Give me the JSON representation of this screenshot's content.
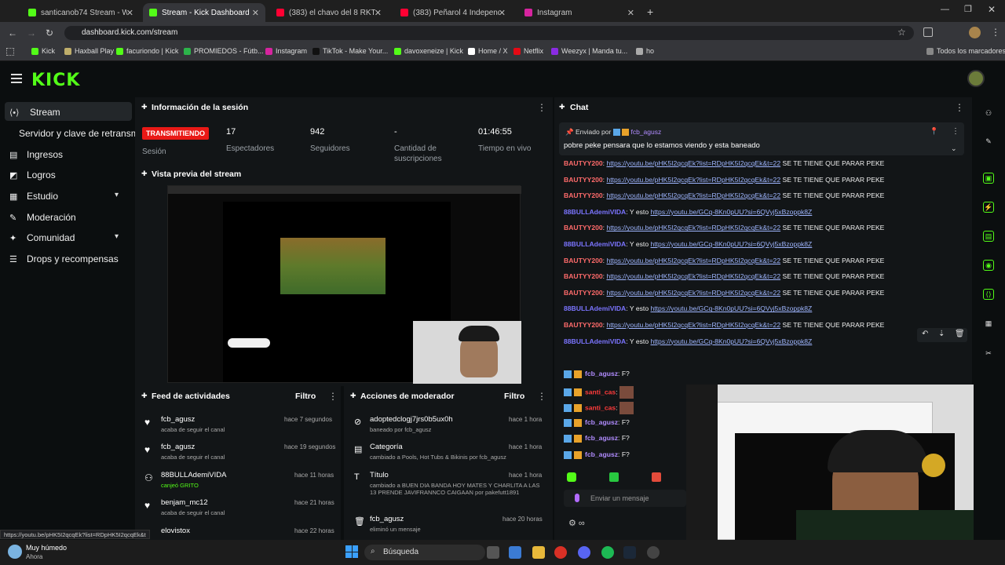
{
  "browser": {
    "tabs": [
      {
        "title": "santicanob74 Stream - Watch L",
        "color": "#53fc18"
      },
      {
        "title": "Stream - Kick Dashboard",
        "color": "#53fc18",
        "active": true
      },
      {
        "title": "(383) el chavo del 8 RKT saturs",
        "color": "#ff0033"
      },
      {
        "title": "(383) Peñarol 4 Independient",
        "color": "#ff0033"
      },
      {
        "title": "Instagram",
        "color": "#d6249f"
      }
    ],
    "url": "dashboard.kick.com/stream",
    "bookmarks": [
      "Kick",
      "Haxball Play",
      "facuriondo | Kick",
      "PROMIEDOS - Fútb...",
      "Instagram",
      "TikTok - Make Your...",
      "davoxeneize | Kick",
      "Home / X",
      "Netflix",
      "Weezyx | Manda tu...",
      "ho"
    ],
    "all_bookmarks": "Todos los marcadores"
  },
  "kick": {
    "logo": "KICK",
    "sidebar": {
      "stream": "Stream",
      "server": "Servidor y clave de retransmi",
      "items": [
        "Ingresos",
        "Logros",
        "Estudio",
        "Moderación",
        "Comunidad",
        "Drops y recompensas"
      ]
    },
    "session": {
      "title": "Información de la sesión",
      "live_badge": "TRANSMITIENDO",
      "session_label": "Sesión",
      "viewers": "17",
      "viewers_label": "Espectadores",
      "followers": "942",
      "followers_label": "Seguidores",
      "subs": "-",
      "subs_label": "Cantidad de suscripciones",
      "time": "01:46:55",
      "time_label": "Tiempo en vivo"
    },
    "preview_title": "Vista previa del stream",
    "feed": {
      "title": "Feed de actividades",
      "filter": "Filtro",
      "rows": [
        {
          "name": "fcb_agusz",
          "sub": "acaba de seguir el canal",
          "time": "hace 7 segundos"
        },
        {
          "name": "fcb_agusz",
          "sub": "acaba de seguir el canal",
          "time": "hace 19 segundos"
        },
        {
          "name": "88BULLAdemiVIDA",
          "sub": "canjeó GRITO",
          "time": "hace 11 horas"
        },
        {
          "name": "benjam_mc12",
          "sub": "acaba de seguir el canal",
          "time": "hace 21 horas"
        },
        {
          "name": "elovistox",
          "sub": "",
          "time": "hace 22 horas"
        }
      ]
    },
    "mod": {
      "title": "Acciones de moderador",
      "filter": "Filtro",
      "rows": [
        {
          "name": "adoptedclogj7jrs0b5ux0h",
          "sub": "baneado por fcb_agusz",
          "time": "hace 1 hora"
        },
        {
          "name": "Categoría",
          "sub": "cambiado a Pools, Hot Tubs & Bikinis por fcb_agusz",
          "time": "hace 1 hora"
        },
        {
          "name": "Título",
          "sub": "cambiado a BUEN DIA BANDA HOY MATES Y CHARLITA A LAS 13 PRENDE JAVIFRANNCO CAIGAAN por pakefutt1891",
          "time": "hace 1 hora"
        },
        {
          "name": "fcb_agusz",
          "sub": "eliminó un mensaje",
          "time": "hace 20 horas"
        }
      ]
    },
    "chat": {
      "title": "Chat",
      "pinned_by": "Enviado por",
      "pinned_user": "fcb_agusz",
      "pinned_msg": "pobre peke pensara que lo estamos viendo y esta baneado",
      "lines": [
        {
          "u": "BAUTYY200",
          "c": "u1",
          "link": "https://youtu.be/pHK5I2qcqEk?list=RDpHK5I2qcqEk&t=22",
          "rest": "SE TE TIENE QUE PARAR PEKE"
        },
        {
          "u": "BAUTYY200",
          "c": "u1",
          "link": "https://youtu.be/pHK5I2qcqEk?list=RDpHK5I2qcqEk&t=22",
          "rest": "SE TE TIENE QUE PARAR PEKE"
        },
        {
          "u": "BAUTYY200",
          "c": "u1",
          "link": "https://youtu.be/pHK5I2qcqEk?list=RDpHK5I2qcqEk&t=22",
          "rest": "SE TE TIENE QUE PARAR PEKE"
        },
        {
          "u": "88BULLAdemiVIDA",
          "c": "u2",
          "pre": "Y esto",
          "link": "https://youtu.be/GCq-8Kn0pUU?si=6QVyj5xBzoppk8Z",
          "rest": ""
        },
        {
          "u": "BAUTYY200",
          "c": "u1",
          "link": "https://youtu.be/pHK5I2qcqEk?list=RDpHK5I2qcqEk&t=22",
          "rest": "SE TE TIENE QUE PARAR PEKE"
        },
        {
          "u": "88BULLAdemiVIDA",
          "c": "u2",
          "pre": "Y esto",
          "link": "https://youtu.be/GCq-8Kn0pUU?si=6QVyj5xBzoppk8Z",
          "rest": ""
        },
        {
          "u": "BAUTYY200",
          "c": "u1",
          "link": "https://youtu.be/pHK5I2qcqEk?list=RDpHK5I2qcqEk&t=22",
          "rest": "SE TE TIENE QUE PARAR PEKE"
        },
        {
          "u": "BAUTYY200",
          "c": "u1",
          "link": "https://youtu.be/pHK5I2qcqEk?list=RDpHK5I2qcqEk&t=22",
          "rest": "SE TE TIENE QUE PARAR PEKE"
        },
        {
          "u": "BAUTYY200",
          "c": "u1",
          "link": "https://youtu.be/pHK5I2qcqEk?list=RDpHK5I2qcqEk&t=22",
          "rest": "SE TE TIENE QUE PARAR PEKE"
        },
        {
          "u": "88BULLAdemiVIDA",
          "c": "u2",
          "pre": "Y esto",
          "link": "https://youtu.be/GCq-8Kn0pUU?si=6QVyj5xBzoppk8Z",
          "rest": ""
        },
        {
          "u": "BAUTYY200",
          "c": "u1",
          "link": "https://youtu.be/pHK5I2qcqEk?list=RDpHK5I2qcqEk&t=22",
          "rest": "SE TE TIENE QUE PARAR PEKE"
        },
        {
          "u": "88BULLAdemiVIDA",
          "c": "u2",
          "pre": "Y esto",
          "link": "https://youtu.be/GCq-8Kn0pUU?si=6QVyj5xBzoppk8Z",
          "rest": ""
        }
      ],
      "short_lines": [
        {
          "u": "fcb_agusz",
          "msg": "F?"
        },
        {
          "u": "santi_cas",
          "msg": ""
        },
        {
          "u": "santi_cas",
          "msg": ""
        },
        {
          "u": "fcb_agusz",
          "msg": "F?"
        },
        {
          "u": "fcb_agusz",
          "msg": "F?"
        },
        {
          "u": "fcb_agusz",
          "msg": "F?"
        }
      ],
      "input_placeholder": "Enviar un mensaje"
    }
  },
  "status_url": "https://youtu.be/pHK5I2qcqEk?list=RDpHK5I2qcqEk&t",
  "taskbar": {
    "weather": "Muy húmedo",
    "weather_sub": "Ahora",
    "search": "Búsqueda"
  }
}
